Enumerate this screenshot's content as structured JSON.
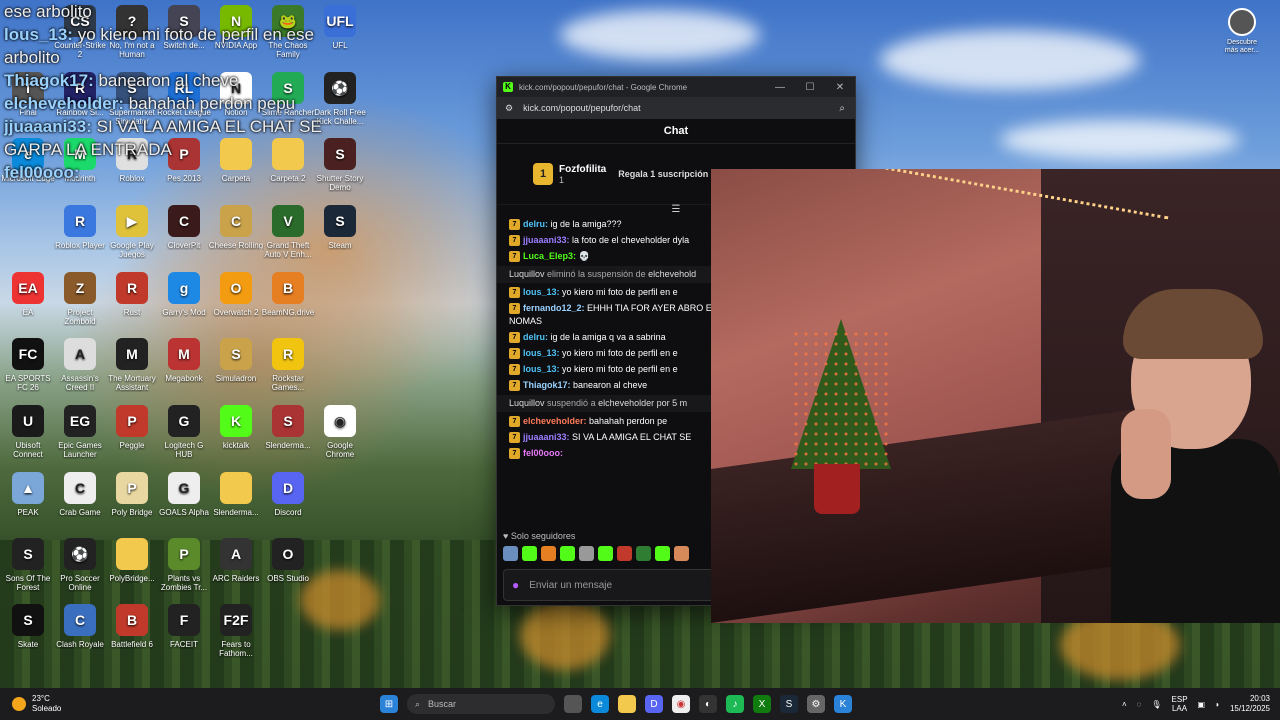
{
  "overlay_chat": [
    {
      "text": "ese arbolito"
    },
    {
      "user": "lous_13:",
      "text": "yo kiero mi foto de perfil en ese arbolito"
    },
    {
      "user": "Thiagok17:",
      "text": "banearon al cheve"
    },
    {
      "user": "elcheveholder:",
      "text": "bahahah perdon pepu"
    },
    {
      "user": "jjuaaani33:",
      "text": "SI VA LA AMIGA EL CHAT SE GARPA LA ENTRADA"
    },
    {
      "user": "fel00ooo:",
      "text": ""
    }
  ],
  "desktop_icons": [
    {
      "label": "Counter-Strike 2",
      "color": "#2e3a4a",
      "glyph": "CS"
    },
    {
      "label": "No, I'm not a Human",
      "color": "#333",
      "glyph": "?"
    },
    {
      "label": "Switch de...",
      "color": "#445",
      "glyph": "S"
    },
    {
      "label": "NVIDIA App",
      "color": "#76b900",
      "glyph": "N"
    },
    {
      "label": "The Chaos Family",
      "color": "#3a7a2a",
      "glyph": "🐸"
    },
    {
      "label": "UFL",
      "color": "#3b6fd8",
      "glyph": "UFL"
    },
    {
      "label": "Final",
      "color": "#555",
      "glyph": "T"
    },
    {
      "label": "Rainbow Si...",
      "color": "#226",
      "glyph": "R"
    },
    {
      "label": "Supermarket Simulator",
      "color": "#35507a",
      "glyph": "S"
    },
    {
      "label": "Rocket League",
      "color": "#1d6fd6",
      "glyph": "RL"
    },
    {
      "label": "Notion",
      "color": "#fff",
      "glyph": "N"
    },
    {
      "label": "Slime Rancher",
      "color": "#2a5",
      "glyph": "S"
    },
    {
      "label": "Dark Roll Free Kick Challe...",
      "color": "#222",
      "glyph": "⚽"
    },
    {
      "label": "Microsoft Edge",
      "color": "#0b8adb",
      "glyph": "e"
    },
    {
      "label": "Modrinth",
      "color": "#1bd96a",
      "glyph": "M"
    },
    {
      "label": "Roblox",
      "color": "#e0e0e0",
      "glyph": "R"
    },
    {
      "label": "Pes 2013",
      "color": "#a33",
      "glyph": "P"
    },
    {
      "label": "Carpeta",
      "color": "#f2c94c",
      "glyph": ""
    },
    {
      "label": "Carpeta 2",
      "color": "#f2c94c",
      "glyph": ""
    },
    {
      "label": "Shutter Story Demo",
      "color": "#4a2020",
      "glyph": "S"
    },
    {
      "label": "Roblox Player",
      "color": "#3a78e0",
      "glyph": "R"
    },
    {
      "label": "Google Play Juegos",
      "color": "#dfc23a",
      "glyph": "▶"
    },
    {
      "label": "CloverPit",
      "color": "#3a1a1a",
      "glyph": "C"
    },
    {
      "label": "Cheese Rolling",
      "color": "#c9a24a",
      "glyph": "C"
    },
    {
      "label": "Grand Theft Auto V Enh...",
      "color": "#2a6a2a",
      "glyph": "V"
    },
    {
      "label": "Steam",
      "color": "#1b2838",
      "glyph": "S"
    },
    {
      "label": "EA",
      "color": "#e33",
      "glyph": "EA"
    },
    {
      "label": "Project Zomboid",
      "color": "#8a5a2a",
      "glyph": "Z"
    },
    {
      "label": "Rust",
      "color": "#c0392b",
      "glyph": "R"
    },
    {
      "label": "Garry's Mod",
      "color": "#1e88e5",
      "glyph": "g"
    },
    {
      "label": "Overwatch 2",
      "color": "#f39c12",
      "glyph": "O"
    },
    {
      "label": "BeamNG.drive",
      "color": "#e67e22",
      "glyph": "B"
    },
    {
      "label": "EA SPORTS FC 26",
      "color": "#111",
      "glyph": "FC"
    },
    {
      "label": "Assassin's Creed II",
      "color": "#ddd",
      "glyph": "A"
    },
    {
      "label": "The Mortuary Assistant",
      "color": "#222",
      "glyph": "M"
    },
    {
      "label": "Megabonk",
      "color": "#b33",
      "glyph": "M"
    },
    {
      "label": "Simuladron",
      "color": "#c9a24a",
      "glyph": "S"
    },
    {
      "label": "Rockstar Games...",
      "color": "#f1c40f",
      "glyph": "R"
    },
    {
      "label": "Ubisoft Connect",
      "color": "#1a1a1a",
      "glyph": "U"
    },
    {
      "label": "Epic Games Launcher",
      "color": "#222",
      "glyph": "EG"
    },
    {
      "label": "Peggle",
      "color": "#c0392b",
      "glyph": "P"
    },
    {
      "label": "Logitech G HUB",
      "color": "#222",
      "glyph": "G"
    },
    {
      "label": "kicktalk",
      "color": "#53fc18",
      "glyph": "K"
    },
    {
      "label": "Slenderma...",
      "color": "#a33",
      "glyph": "S"
    },
    {
      "label": "Google Chrome",
      "color": "#fff",
      "glyph": "◉"
    },
    {
      "label": "PEAK",
      "color": "#7aa6d8",
      "glyph": "▲"
    },
    {
      "label": "Crab Game",
      "color": "#eee",
      "glyph": "C"
    },
    {
      "label": "Poly Bridge",
      "color": "#e8d7a0",
      "glyph": "P"
    },
    {
      "label": "GOALS Alpha",
      "color": "#eee",
      "glyph": "G"
    },
    {
      "label": "Slenderma...",
      "color": "#f2c94c",
      "glyph": ""
    },
    {
      "label": "Discord",
      "color": "#5865f2",
      "glyph": "D"
    },
    {
      "label": "Sons Of The Forest",
      "color": "#222",
      "glyph": "S"
    },
    {
      "label": "Pro Soccer Online",
      "color": "#222",
      "glyph": "⚽"
    },
    {
      "label": "PolyBridge...",
      "color": "#f2c94c",
      "glyph": ""
    },
    {
      "label": "Plants vs Zombies Tr...",
      "color": "#5a8a2a",
      "glyph": "P"
    },
    {
      "label": "ARC Raiders",
      "color": "#333",
      "glyph": "A"
    },
    {
      "label": "OBS Studio",
      "color": "#222",
      "glyph": "O"
    },
    {
      "label": "Skate",
      "color": "#111",
      "glyph": "S"
    },
    {
      "label": "Clash Royale",
      "color": "#3a6fc0",
      "glyph": "C"
    },
    {
      "label": "Battlefield 6",
      "color": "#c0392b",
      "glyph": "B"
    },
    {
      "label": "FACEIT",
      "color": "#222",
      "glyph": "F"
    },
    {
      "label": "Fears to Fathom...",
      "color": "#222",
      "glyph": "F2F"
    }
  ],
  "corner_icon": {
    "label": "Descubre más acer..."
  },
  "browser": {
    "title": "kick.com/popout/pepufor/chat - Google Chrome",
    "url": "kick.com/popout/pepufor/chat",
    "controls": [
      "—",
      "☐",
      "✕"
    ]
  },
  "chat": {
    "header": "Chat",
    "pinned_rank": "1",
    "pinned_user": "Fozfofilita",
    "pinned_count": "1",
    "gift_text": "Regala 1 suscripción",
    "messages": [
      {
        "type": "msg",
        "user": "delru:",
        "color": "#4fc3f7",
        "text": "ig de la amiga???"
      },
      {
        "type": "msg",
        "user": "jjuaaani33:",
        "color": "#9b7dff",
        "text": "la foto de el cheveholder dyla"
      },
      {
        "type": "msg",
        "user": "Luca_Elep3:",
        "color": "#53fc18",
        "text": "💀"
      },
      {
        "type": "sys",
        "user": "Luquillov",
        "text": "eliminó la suspensión de",
        "target": "elchevehold"
      },
      {
        "type": "msg",
        "user": "lous_13:",
        "color": "#4fc3f7",
        "text": "yo kiero mi foto de perfil en e"
      },
      {
        "type": "msg",
        "wrap": true,
        "user": "fernando12_2:",
        "color": "#9ad2ff",
        "text": "EHHH TIA FOR AYER ABRO EL GUITA ES UNA RATITA NOMAS"
      },
      {
        "type": "msg",
        "user": "delru:",
        "color": "#4fc3f7",
        "text": "ig de la amiga q va a sabrina"
      },
      {
        "type": "msg",
        "user": "lous_13:",
        "color": "#4fc3f7",
        "text": "yo kiero mi foto de perfil en e"
      },
      {
        "type": "msg",
        "user": "lous_13:",
        "color": "#4fc3f7",
        "text": "yo kiero mi foto de perfil en e"
      },
      {
        "type": "msg",
        "user": "Thiagok17:",
        "color": "#9ad2ff",
        "text": "banearon al cheve"
      },
      {
        "type": "sys",
        "user": "Luquillov",
        "text": "suspendió a",
        "target": "elcheveholder por 5 m"
      },
      {
        "type": "msg",
        "user": "elcheveholder:",
        "color": "#ff7a59",
        "text": "bahahah perdon pe"
      },
      {
        "type": "msg",
        "user": "jjuaaani33:",
        "color": "#9b7dff",
        "text": "SI VA LA AMIGA EL CHAT SE"
      },
      {
        "type": "msg",
        "user": "fel00ooo:",
        "color": "#e879f9",
        "text": ""
      }
    ],
    "followers_label": "Solo seguidores",
    "input_placeholder": "Enviar un mensaje"
  },
  "taskbar": {
    "temp": "23°C",
    "weather": "Soleado",
    "search_placeholder": "Buscar",
    "lang_top": "ESP",
    "lang_bottom": "LAA",
    "time": "20:03",
    "date": "15/12/2025"
  }
}
